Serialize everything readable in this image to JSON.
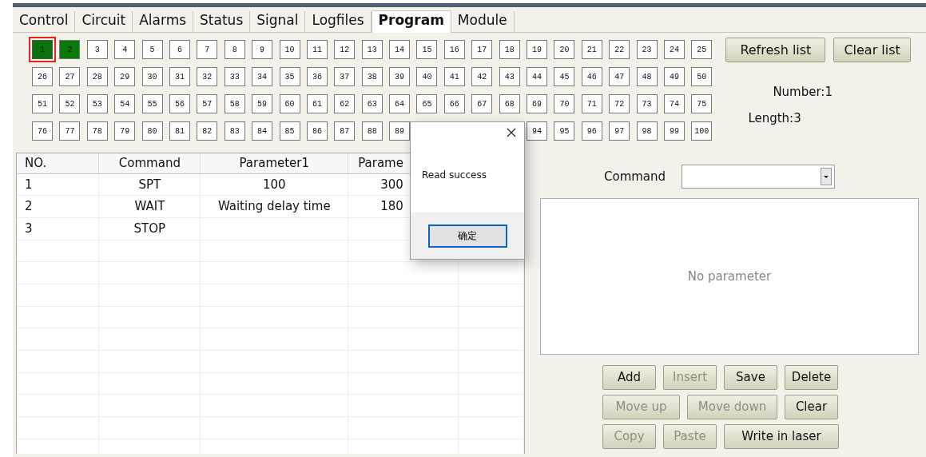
{
  "tabs": [
    {
      "label": "Control",
      "selected": false
    },
    {
      "label": "Circuit",
      "selected": false
    },
    {
      "label": "Alarms",
      "selected": false
    },
    {
      "label": "Status",
      "selected": false
    },
    {
      "label": "Signal",
      "selected": false
    },
    {
      "label": "Logfiles",
      "selected": false
    },
    {
      "label": "Program",
      "selected": true
    },
    {
      "label": "Module",
      "selected": false
    }
  ],
  "slots": [
    {
      "kind": "slot",
      "label": "1",
      "filled": true,
      "selected": true
    },
    {
      "kind": "slot",
      "label": "2",
      "filled": true,
      "selected": false
    },
    {
      "kind": "slot",
      "label": "3",
      "filled": false,
      "selected": false
    },
    {
      "kind": "slot",
      "label": "4",
      "filled": false,
      "selected": false
    },
    {
      "kind": "slot",
      "label": "5",
      "filled": false,
      "selected": false
    },
    {
      "kind": "slot",
      "label": "6",
      "filled": false,
      "selected": false
    },
    {
      "kind": "slot",
      "label": "7",
      "filled": false,
      "selected": false
    },
    {
      "kind": "slot",
      "label": "8",
      "filled": false,
      "selected": false
    },
    {
      "kind": "slot",
      "label": "9",
      "filled": false,
      "selected": false
    },
    {
      "kind": "slot",
      "label": "10",
      "filled": false,
      "selected": false
    },
    {
      "kind": "slot",
      "label": "11",
      "filled": false,
      "selected": false
    },
    {
      "kind": "slot",
      "label": "12",
      "filled": false,
      "selected": false
    },
    {
      "kind": "slot",
      "label": "13",
      "filled": false,
      "selected": false
    },
    {
      "kind": "slot",
      "label": "14",
      "filled": false,
      "selected": false
    },
    {
      "kind": "slot",
      "label": "15",
      "filled": false,
      "selected": false
    },
    {
      "kind": "slot",
      "label": "16",
      "filled": false,
      "selected": false
    },
    {
      "kind": "slot",
      "label": "17",
      "filled": false,
      "selected": false
    },
    {
      "kind": "slot",
      "label": "18",
      "filled": false,
      "selected": false
    },
    {
      "kind": "slot",
      "label": "19",
      "filled": false,
      "selected": false
    },
    {
      "kind": "slot",
      "label": "20",
      "filled": false,
      "selected": false
    },
    {
      "kind": "slot",
      "label": "21",
      "filled": false,
      "selected": false
    },
    {
      "kind": "slot",
      "label": "22",
      "filled": false,
      "selected": false
    },
    {
      "kind": "slot",
      "label": "23",
      "filled": false,
      "selected": false
    },
    {
      "kind": "slot",
      "label": "24",
      "filled": false,
      "selected": false
    },
    {
      "kind": "slot",
      "label": "25",
      "filled": false,
      "selected": false
    },
    {
      "kind": "slot",
      "label": "26",
      "filled": false,
      "selected": false
    },
    {
      "kind": "slot",
      "label": "27",
      "filled": false,
      "selected": false
    },
    {
      "kind": "slot",
      "label": "28",
      "filled": false,
      "selected": false
    },
    {
      "kind": "slot",
      "label": "29",
      "filled": false,
      "selected": false
    },
    {
      "kind": "slot",
      "label": "30",
      "filled": false,
      "selected": false
    },
    {
      "kind": "slot",
      "label": "31",
      "filled": false,
      "selected": false
    },
    {
      "kind": "slot",
      "label": "32",
      "filled": false,
      "selected": false
    },
    {
      "kind": "slot",
      "label": "33",
      "filled": false,
      "selected": false
    },
    {
      "kind": "slot",
      "label": "34",
      "filled": false,
      "selected": false
    },
    {
      "kind": "slot",
      "label": "35",
      "filled": false,
      "selected": false
    },
    {
      "kind": "slot",
      "label": "36",
      "filled": false,
      "selected": false
    },
    {
      "kind": "slot",
      "label": "37",
      "filled": false,
      "selected": false
    },
    {
      "kind": "slot",
      "label": "38",
      "filled": false,
      "selected": false
    },
    {
      "kind": "slot",
      "label": "39",
      "filled": false,
      "selected": false
    },
    {
      "kind": "slot",
      "label": "40",
      "filled": false,
      "selected": false
    },
    {
      "kind": "slot",
      "label": "41",
      "filled": false,
      "selected": false
    },
    {
      "kind": "slot",
      "label": "42",
      "filled": false,
      "selected": false
    },
    {
      "kind": "slot",
      "label": "43",
      "filled": false,
      "selected": false
    },
    {
      "kind": "slot",
      "label": "44",
      "filled": false,
      "selected": false
    },
    {
      "kind": "slot",
      "label": "45",
      "filled": false,
      "selected": false
    },
    {
      "kind": "slot",
      "label": "46",
      "filled": false,
      "selected": false
    },
    {
      "kind": "slot",
      "label": "47",
      "filled": false,
      "selected": false
    },
    {
      "kind": "slot",
      "label": "48",
      "filled": false,
      "selected": false
    },
    {
      "kind": "slot",
      "label": "49",
      "filled": false,
      "selected": false
    },
    {
      "kind": "slot",
      "label": "50",
      "filled": false,
      "selected": false
    },
    {
      "kind": "slot",
      "label": "51",
      "filled": false,
      "selected": false
    },
    {
      "kind": "slot",
      "label": "52",
      "filled": false,
      "selected": false
    },
    {
      "kind": "slot",
      "label": "53",
      "filled": false,
      "selected": false
    },
    {
      "kind": "slot",
      "label": "54",
      "filled": false,
      "selected": false
    },
    {
      "kind": "slot",
      "label": "55",
      "filled": false,
      "selected": false
    },
    {
      "kind": "slot",
      "label": "56",
      "filled": false,
      "selected": false
    },
    {
      "kind": "slot",
      "label": "57",
      "filled": false,
      "selected": false
    },
    {
      "kind": "slot",
      "label": "58",
      "filled": false,
      "selected": false
    },
    {
      "kind": "slot",
      "label": "59",
      "filled": false,
      "selected": false
    },
    {
      "kind": "slot",
      "label": "60",
      "filled": false,
      "selected": false
    },
    {
      "kind": "slot",
      "label": "61",
      "filled": false,
      "selected": false
    },
    {
      "kind": "slot",
      "label": "62",
      "filled": false,
      "selected": false
    },
    {
      "kind": "slot",
      "label": "63",
      "filled": false,
      "selected": false
    },
    {
      "kind": "slot",
      "label": "64",
      "filled": false,
      "selected": false
    },
    {
      "kind": "slot",
      "label": "65",
      "filled": false,
      "selected": false
    },
    {
      "kind": "slot",
      "label": "66",
      "filled": false,
      "selected": false
    },
    {
      "kind": "slot",
      "label": "67",
      "filled": false,
      "selected": false
    },
    {
      "kind": "slot",
      "label": "68",
      "filled": false,
      "selected": false
    },
    {
      "kind": "slot",
      "label": "69",
      "filled": false,
      "selected": false
    },
    {
      "kind": "slot",
      "label": "70",
      "filled": false,
      "selected": false
    },
    {
      "kind": "slot",
      "label": "71",
      "filled": false,
      "selected": false
    },
    {
      "kind": "slot",
      "label": "72",
      "filled": false,
      "selected": false
    },
    {
      "kind": "slot",
      "label": "73",
      "filled": false,
      "selected": false
    },
    {
      "kind": "slot",
      "label": "74",
      "filled": false,
      "selected": false
    },
    {
      "kind": "slot",
      "label": "75",
      "filled": false,
      "selected": false
    },
    {
      "kind": "slot",
      "label": "76",
      "filled": false,
      "selected": false
    },
    {
      "kind": "slot",
      "label": "77",
      "filled": false,
      "selected": false
    },
    {
      "kind": "slot",
      "label": "78",
      "filled": false,
      "selected": false
    },
    {
      "kind": "slot",
      "label": "79",
      "filled": false,
      "selected": false
    },
    {
      "kind": "slot",
      "label": "80",
      "filled": false,
      "selected": false
    },
    {
      "kind": "slot",
      "label": "81",
      "filled": false,
      "selected": false
    },
    {
      "kind": "slot",
      "label": "82",
      "filled": false,
      "selected": false
    },
    {
      "kind": "slot",
      "label": "83",
      "filled": false,
      "selected": false
    },
    {
      "kind": "slot",
      "label": "84",
      "filled": false,
      "selected": false
    },
    {
      "kind": "slot",
      "label": "85",
      "filled": false,
      "selected": false
    },
    {
      "kind": "slot",
      "label": "86",
      "filled": false,
      "selected": false
    },
    {
      "kind": "slot",
      "label": "87",
      "filled": false,
      "selected": false
    },
    {
      "kind": "slot",
      "label": "88",
      "filled": false,
      "selected": false
    },
    {
      "kind": "slot",
      "label": "89",
      "filled": false,
      "selected": false
    },
    {
      "kind": "covered"
    },
    {
      "kind": "covered"
    },
    {
      "kind": "covered"
    },
    {
      "kind": "covered"
    },
    {
      "kind": "slot",
      "label": "94",
      "filled": false,
      "selected": false
    },
    {
      "kind": "slot",
      "label": "95",
      "filled": false,
      "selected": false
    },
    {
      "kind": "slot",
      "label": "96",
      "filled": false,
      "selected": false
    },
    {
      "kind": "slot",
      "label": "97",
      "filled": false,
      "selected": false
    },
    {
      "kind": "slot",
      "label": "98",
      "filled": false,
      "selected": false
    },
    {
      "kind": "slot",
      "label": "99",
      "filled": false,
      "selected": false
    },
    {
      "kind": "slot",
      "label": "100",
      "filled": false,
      "selected": false
    }
  ],
  "list_buttons": [
    {
      "label": "Refresh list"
    },
    {
      "label": "Clear list"
    }
  ],
  "number": "Number:1",
  "length": "Length:3",
  "table": {
    "columns": [
      "NO.",
      "Command",
      "Parameter1",
      "Parame"
    ],
    "rows": [
      [
        "1",
        "SPT",
        "100",
        "300"
      ],
      [
        "2",
        "WAIT",
        "Waiting delay time",
        "180"
      ],
      [
        "3",
        "STOP",
        "",
        ""
      ]
    ]
  },
  "command": {
    "label": "Command"
  },
  "parameter_panel": {
    "message": "No parameter"
  },
  "buttons": [
    [
      {
        "label": "Add",
        "disabled": false
      },
      {
        "label": "Insert",
        "disabled": true
      },
      {
        "label": "Save",
        "disabled": false
      },
      {
        "label": "Delete",
        "disabled": false
      }
    ],
    [
      {
        "label": "Move up",
        "disabled": true
      },
      {
        "label": "Move down",
        "disabled": true
      },
      {
        "label": "Clear",
        "disabled": false
      }
    ],
    [
      {
        "label": "Copy",
        "disabled": true
      },
      {
        "label": "Paste",
        "disabled": true
      },
      {
        "label": "Write in laser",
        "disabled": false
      }
    ]
  ],
  "dialog": {
    "message": "Read success",
    "ok_label": "确定"
  }
}
